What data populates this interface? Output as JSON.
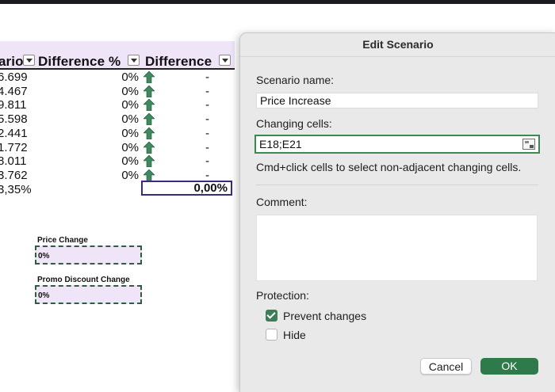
{
  "sheet": {
    "headers": {
      "scenario_partial": "ario",
      "difference_pct": "Difference %",
      "difference": "Difference"
    },
    "rows": [
      {
        "left": "6.699",
        "pct": "0%",
        "diff": "-"
      },
      {
        "left": "4.467",
        "pct": "0%",
        "diff": "-"
      },
      {
        "left": "9.811",
        "pct": "0%",
        "diff": "-"
      },
      {
        "left": "5.598",
        "pct": "0%",
        "diff": "-"
      },
      {
        "left": "2.441",
        "pct": "0%",
        "diff": "-"
      },
      {
        "left": "1.772",
        "pct": "0%",
        "diff": "-"
      },
      {
        "left": "8.011",
        "pct": "0%",
        "diff": "-"
      },
      {
        "left": "3.762",
        "pct": "0%",
        "diff": "-"
      }
    ],
    "total_left": "3,35%",
    "total_diff": "0,00%",
    "price_change": {
      "label": "Price Change",
      "value": "0%"
    },
    "promo_change": {
      "label": "Promo Discount Change",
      "value": "0%"
    },
    "colors": {
      "header_band": "#f0e4f8",
      "arrow": "#3e8a5e",
      "total_border": "#3a2a82"
    }
  },
  "dialog": {
    "title": "Edit Scenario",
    "scenario_name_label": "Scenario name:",
    "scenario_name_value": "Price Increase",
    "changing_cells_label": "Changing cells:",
    "changing_cells_value": "E18;E21",
    "hint": "Cmd+click cells to select non-adjacent changing cells.",
    "comment_label": "Comment:",
    "comment_value": "",
    "protection_label": "Protection:",
    "prevent_changes_label": "Prevent changes",
    "prevent_changes_checked": true,
    "hide_label": "Hide",
    "hide_checked": false,
    "cancel_label": "Cancel",
    "ok_label": "OK",
    "colors": {
      "accent": "#2f7a4b",
      "background": "#eae9ea"
    }
  }
}
